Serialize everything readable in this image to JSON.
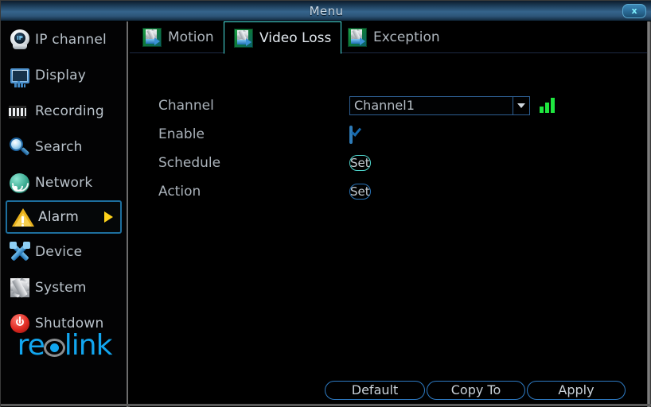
{
  "window": {
    "title": "Menu",
    "close_label": "x"
  },
  "sidebar": {
    "items": [
      {
        "label": "IP channel",
        "icon": "ip-camera-icon",
        "active": false
      },
      {
        "label": "Display",
        "icon": "display-icon",
        "active": false
      },
      {
        "label": "Recording",
        "icon": "recording-icon",
        "active": false
      },
      {
        "label": "Search",
        "icon": "search-icon",
        "active": false
      },
      {
        "label": "Network",
        "icon": "network-icon",
        "active": false
      },
      {
        "label": "Alarm",
        "icon": "alarm-icon",
        "active": true
      },
      {
        "label": "Device",
        "icon": "device-icon",
        "active": false
      },
      {
        "label": "System",
        "icon": "system-icon",
        "active": false
      },
      {
        "label": "Shutdown",
        "icon": "power-icon",
        "active": false
      }
    ],
    "logo": {
      "text_before": "re",
      "text_after": "link",
      "brand": "reolink"
    }
  },
  "tabs": [
    {
      "label": "Motion",
      "icon": "motion-settings-icon",
      "active": false
    },
    {
      "label": "Video Loss",
      "icon": "video-loss-settings-icon",
      "active": true
    },
    {
      "label": "Exception",
      "icon": "exception-settings-icon",
      "active": false
    }
  ],
  "form": {
    "channel": {
      "label": "Channel",
      "value": "Channel1",
      "options": [
        "Channel1"
      ],
      "signal_icon": "signal-strength-icon"
    },
    "enable": {
      "label": "Enable",
      "checked": true
    },
    "schedule": {
      "label": "Schedule",
      "button_label": "Set"
    },
    "action": {
      "label": "Action",
      "button_label": "Set"
    }
  },
  "footer": {
    "default_label": "Default",
    "copyto_label": "Copy To",
    "apply_label": "Apply"
  },
  "colors": {
    "accent_blue": "#12a6ef",
    "tab_active_border": "#49e3e0",
    "signal_green": "#1fe63f",
    "alarm_gold": "#e8b11c",
    "power_red": "#e02a22"
  }
}
